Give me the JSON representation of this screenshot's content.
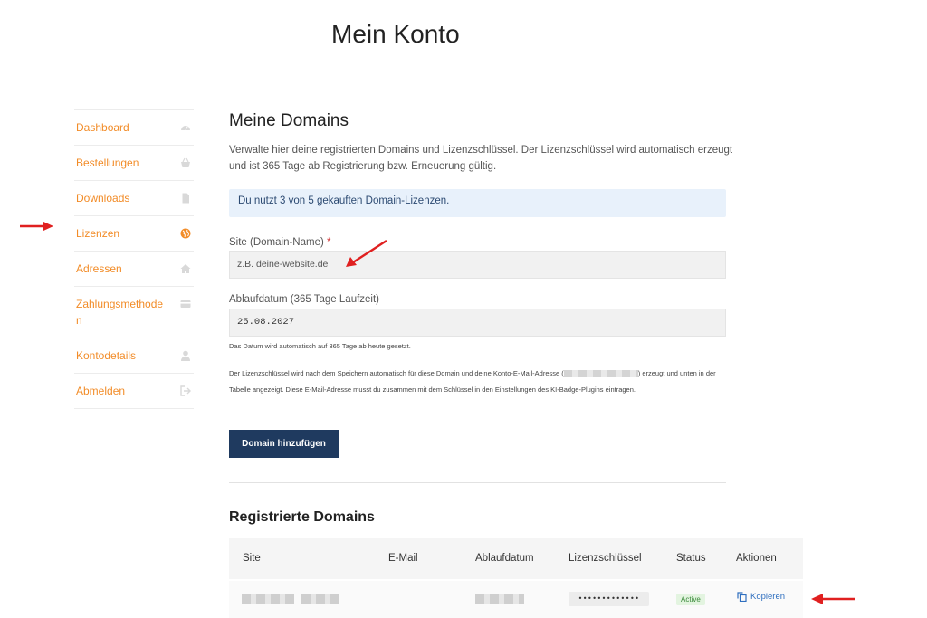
{
  "page": {
    "title": "Mein Konto"
  },
  "sidebar": {
    "items": [
      {
        "label": "Dashboard",
        "icon": "dashboard-gauge-icon"
      },
      {
        "label": "Bestellungen",
        "icon": "basket-icon"
      },
      {
        "label": "Downloads",
        "icon": "file-icon"
      },
      {
        "label": "Lizenzen",
        "icon": "globe-icon",
        "active": true
      },
      {
        "label": "Adressen",
        "icon": "home-icon"
      },
      {
        "label": "Zahlungsmethode\nn",
        "icon": "credit-card-icon"
      },
      {
        "label": "Kontodetails",
        "icon": "user-icon"
      },
      {
        "label": "Abmelden",
        "icon": "logout-icon"
      }
    ]
  },
  "main": {
    "heading": "Meine Domains",
    "intro": "Verwalte hier deine registrierten Domains und Lizenzschlüssel. Der Lizenzschlüssel wird automatisch erzeugt und ist 365 Tage ab Registrierung bzw. Erneuerung gültig.",
    "notice": "Du nutzt 3 von 5 gekauften Domain-Lizenzen.",
    "form": {
      "site_label": "Site (Domain-Name)",
      "site_required": "*",
      "site_placeholder": "z.B. deine-website.de",
      "expiry_label": "Ablaufdatum (365 Tage Laufzeit)",
      "expiry_value": "25.08.2027",
      "expiry_hint": "Das Datum wird automatisch auf 365 Tage ab heute gesetzt.",
      "info_part1": "Der Lizenzschlüssel wird nach dem Speichern automatisch für diese Domain und deine Konto-E-Mail-Adresse (",
      "info_part2": ") erzeugt und unten in der Tabelle angezeigt. Diese E-Mail-Adresse musst du zusammen mit dem Schlüssel in den Einstellungen des KI-Badge-Plugins eintragen.",
      "submit_label": "Domain hinzufügen"
    },
    "table": {
      "heading": "Registrierte Domains",
      "columns": [
        "Site",
        "E-Mail",
        "Ablaufdatum",
        "Lizenzschlüssel",
        "Status",
        "Aktionen"
      ],
      "rows": [
        {
          "key_masked": "•••••••••••••",
          "status": "Active",
          "action": "Kopieren"
        }
      ]
    }
  },
  "colors": {
    "accent": "#f28c28",
    "primary": "#1f3a5f",
    "link": "#2f6fbf",
    "annotation": "#e02020"
  }
}
